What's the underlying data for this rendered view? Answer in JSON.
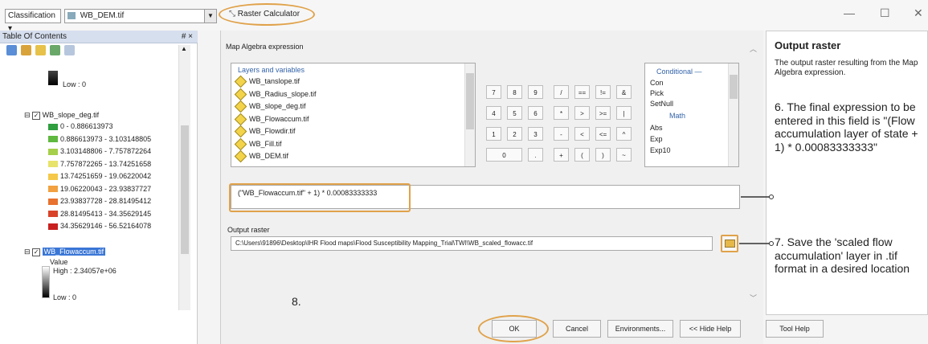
{
  "topbar": {
    "classification_label": "Classification",
    "layer_combo_value": "WB_DEM.tif",
    "window_title": "Raster Calculator",
    "minimize": "—",
    "maximize": "☐",
    "close": "✕"
  },
  "toc": {
    "title": "Table Of Contents",
    "pin": "# ×",
    "low_top": "Low : 0",
    "slope_layer": "WB_slope_deg.tif",
    "slope_classes": [
      {
        "label": "0 - 0.886613973",
        "color": "#2e9e3e"
      },
      {
        "label": "0.886613973 - 3.103148805",
        "color": "#5fb83f"
      },
      {
        "label": "3.103148806 - 7.757872264",
        "color": "#a6cf4a"
      },
      {
        "label": "7.757872265 - 13.74251658",
        "color": "#e8e36a"
      },
      {
        "label": "13.74251659 - 19.06220042",
        "color": "#f5c84a"
      },
      {
        "label": "19.06220043 - 23.93837727",
        "color": "#f2a040"
      },
      {
        "label": "23.93837728 - 28.81495412",
        "color": "#e8722f"
      },
      {
        "label": "28.81495413 - 34.35629145",
        "color": "#d9432a"
      },
      {
        "label": "34.35629146 - 56.52164078",
        "color": "#c8201f"
      }
    ],
    "flowaccum_layer": "WB_Flowaccum.tif",
    "value_label": "Value",
    "high_label": "High : 2.34057e+06",
    "low_bottom": "Low : 0"
  },
  "dialog": {
    "map_algebra_label": "Map Algebra expression",
    "layers_header": "Layers and variables",
    "layers": [
      "WB_tanslope.tif",
      "WB_Radius_slope.tif",
      "WB_slope_deg.tif",
      "WB_Flowaccum.tif",
      "WB_Flowdir.tif",
      "WB_Fill.tif",
      "WB_DEM.tif"
    ],
    "keypad": [
      [
        "7",
        "8",
        "9",
        "/",
        "==",
        "!=",
        "&"
      ],
      [
        "4",
        "5",
        "6",
        "*",
        ">",
        ">=",
        "|"
      ],
      [
        "1",
        "2",
        "3",
        "-",
        "<",
        "<=",
        "^"
      ],
      [
        "0",
        "",
        ".",
        "+",
        "(",
        ")",
        "~"
      ]
    ],
    "conditional_header": "Conditional —",
    "conditional_items": [
      "Con",
      "Pick",
      "SetNull"
    ],
    "math_header": "Math",
    "math_items": [
      "Abs",
      "Exp",
      "Exp10"
    ],
    "expression": "(\"WB_Flowaccum.tif\" + 1) * 0.00083333333",
    "output_label": "Output raster",
    "output_path": "C:\\Users\\91896\\Desktop\\IHR Flood maps\\Flood Susceptibility Mapping_Trial\\TWI\\WB_scaled_flowacc.tif",
    "buttons": {
      "ok": "OK",
      "cancel": "Cancel",
      "environments": "Environments...",
      "hide_help": "<< Hide Help",
      "tool_help": "Tool Help"
    }
  },
  "help": {
    "title": "Output raster",
    "body": "The output raster resulting from the Map Algebra expression."
  },
  "annotations": {
    "step6": "6. The final expression to be entered in this field is \"(Flow accumulation layer of state + 1) * 0.00083333333\"",
    "step7": "7. Save the 'scaled flow accumulation' layer in .tif format in a desired location",
    "step8": "8.",
    "highlight_color": "#e0a24a"
  }
}
